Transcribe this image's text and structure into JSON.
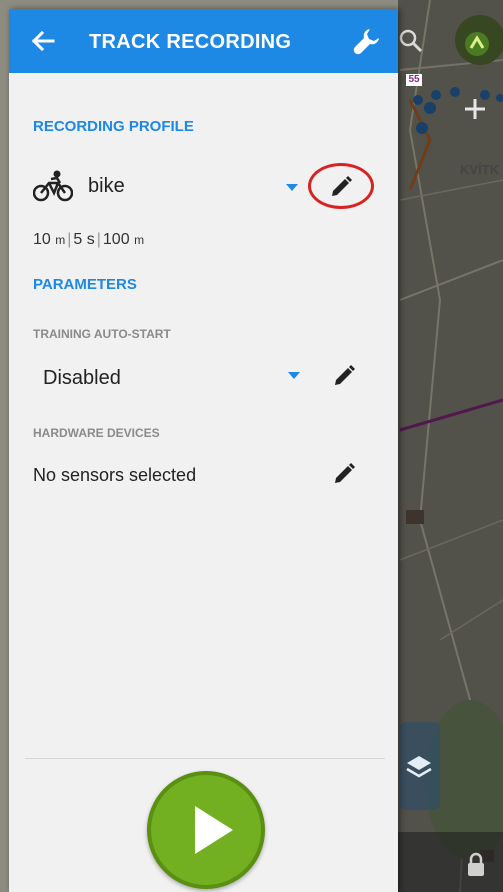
{
  "appbar": {
    "title": "TRACK RECORDING",
    "back_icon": "arrow-left-icon",
    "settings_icon": "wrench-icon",
    "color": "#1e88e5"
  },
  "recording_profile": {
    "section_title": "RECORDING PROFILE",
    "profile_icon": "bicycle-icon",
    "profile_name": "bike",
    "meta": {
      "distance_value": "10",
      "distance_unit": "m",
      "time": "5 s",
      "accuracy_value": "100",
      "accuracy_unit": "m"
    }
  },
  "parameters": {
    "section_title": "PARAMETERS",
    "auto_start": {
      "label": "TRAINING AUTO-START",
      "value": "Disabled"
    },
    "hardware": {
      "label": "HARDWARE DEVICES",
      "value": "No sensors selected"
    }
  },
  "map": {
    "label": "KVÍTK",
    "badge": "55",
    "icons": [
      "search-icon",
      "zoom-in-icon",
      "layers-icon",
      "lock-icon",
      "gps-icon"
    ]
  },
  "actions": {
    "start_icon": "play-icon",
    "start_color": "#72b022"
  }
}
